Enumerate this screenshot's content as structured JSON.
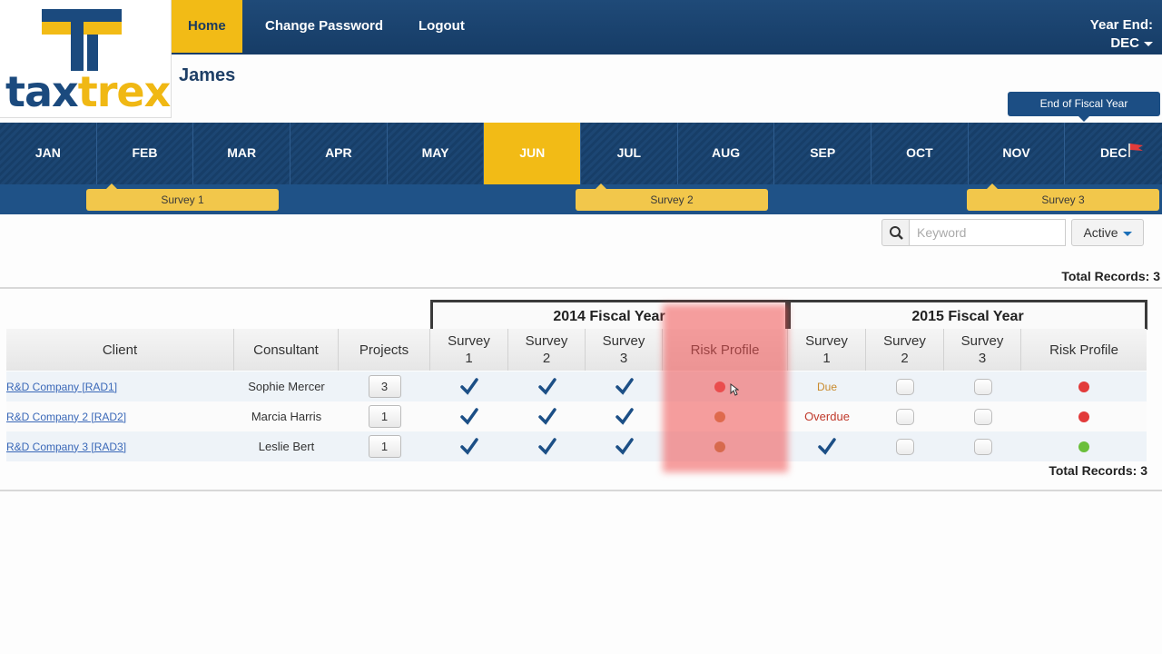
{
  "brand": {
    "logo_text_dark": "tax",
    "logo_text_light": "trex",
    "colors": {
      "navy": "#1b4a7e",
      "gold": "#f2bb16"
    }
  },
  "nav": {
    "items": [
      {
        "label": "Home",
        "active": true
      },
      {
        "label": "Change Password",
        "active": false
      },
      {
        "label": "Logout",
        "active": false
      }
    ],
    "year_end_label": "Year End:",
    "year_end_value": "DEC"
  },
  "user": {
    "name": "James"
  },
  "fiscal_tab": {
    "label": "End of Fiscal Year"
  },
  "months": [
    "JAN",
    "FEB",
    "MAR",
    "APR",
    "MAY",
    "JUN",
    "JUL",
    "AUG",
    "SEP",
    "OCT",
    "NOV",
    "DEC"
  ],
  "active_month": "JUN",
  "surveys": [
    {
      "label": "Survey 1"
    },
    {
      "label": "Survey 2"
    },
    {
      "label": "Survey 3"
    }
  ],
  "search": {
    "placeholder": "Keyword",
    "filter_label": "Active"
  },
  "total_records": {
    "label": "Total Records:",
    "count": "3"
  },
  "table": {
    "fiscal_years": [
      "2014 Fiscal Year",
      "2015 Fiscal Year"
    ],
    "columns": {
      "client": "Client",
      "consultant": "Consultant",
      "projects": "Projects",
      "survey1_a": "Survey",
      "survey1_b": "1",
      "survey2_a": "Survey",
      "survey2_b": "2",
      "survey3_a": "Survey",
      "survey3_b": "3",
      "risk": "Risk Profile"
    },
    "rows": [
      {
        "client": "R&D Company [RAD1]",
        "consultant": "Sophie Mercer",
        "projects": "3",
        "fy2014": {
          "s1": "checked",
          "s2": "checked",
          "s3": "checked",
          "risk_color": "#e24a4a"
        },
        "fy2015": {
          "s1_text": "Due",
          "s1": "text",
          "s2": "empty",
          "s3": "empty",
          "risk_color": "#e23b3b"
        }
      },
      {
        "client": "R&D Company 2 [RAD2]",
        "consultant": "Marcia Harris",
        "projects": "1",
        "fy2014": {
          "s1": "checked",
          "s2": "checked",
          "s3": "checked",
          "risk_color": "#c98a4a"
        },
        "fy2015": {
          "s1_text": "Overdue",
          "s1": "text",
          "s2": "empty",
          "s3": "empty",
          "risk_color": "#e23b3b"
        }
      },
      {
        "client": "R&D Company 3 [RAD3]",
        "consultant": "Leslie Bert",
        "projects": "1",
        "fy2014": {
          "s1": "checked",
          "s2": "checked",
          "s3": "checked",
          "risk_color": "#b98a4a"
        },
        "fy2015": {
          "s1_text": "",
          "s1": "checked",
          "s2": "empty",
          "s3": "empty",
          "risk_color": "#6bbf3b"
        }
      }
    ]
  }
}
